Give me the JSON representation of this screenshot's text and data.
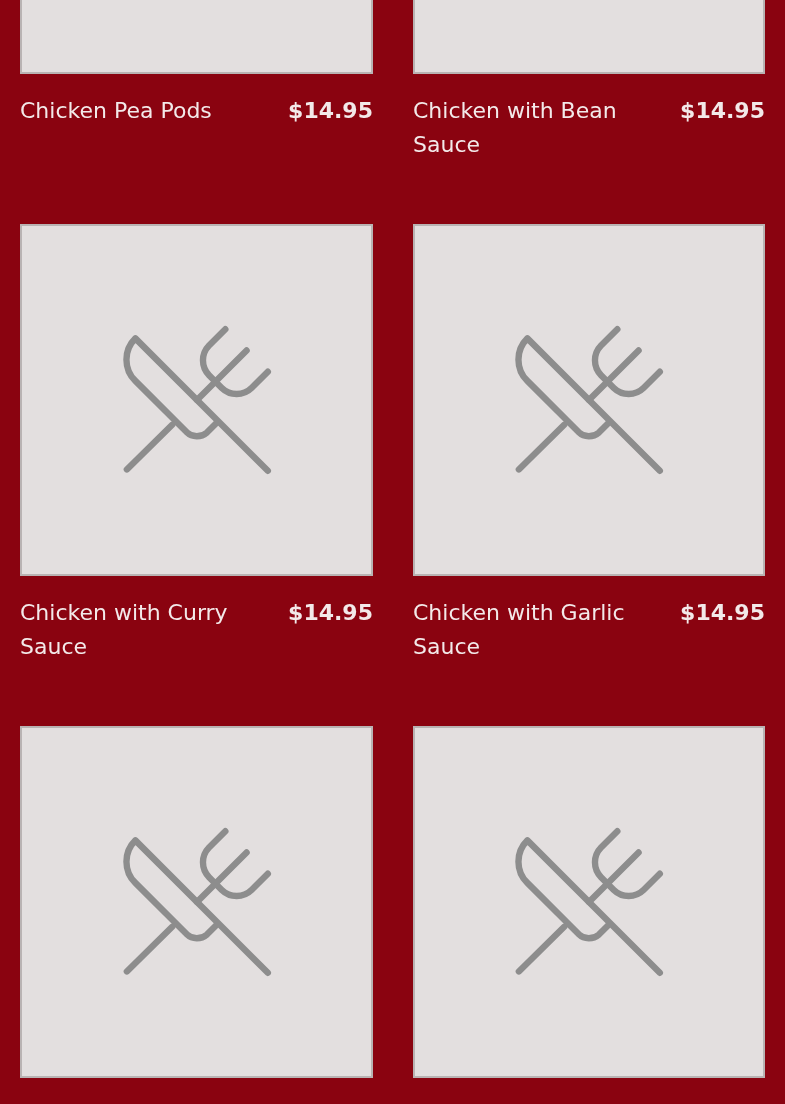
{
  "menu_items": [
    {
      "kind": "clipped",
      "name": "Chicken Pea Pods",
      "price": "$14.95"
    },
    {
      "kind": "clipped",
      "name": "Chicken with Bean Sauce",
      "price": "$14.95"
    },
    {
      "kind": "full",
      "name": "Chicken with Curry Sauce",
      "price": "$14.95"
    },
    {
      "kind": "full",
      "name": "Chicken with Garlic Sauce",
      "price": "$14.95"
    },
    {
      "kind": "full"
    },
    {
      "kind": "full"
    }
  ]
}
